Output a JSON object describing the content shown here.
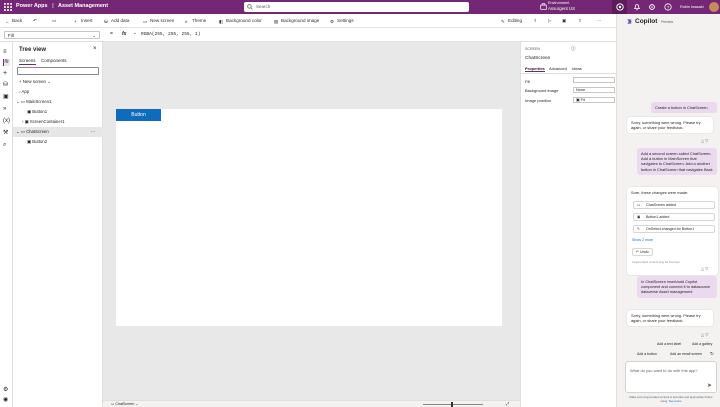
{
  "header": {
    "app_name": "Power Apps",
    "separator": "|",
    "project": "Asset Management",
    "search_placeholder": "Search",
    "environment_label": "Environment",
    "environment_name": "Assurgent US",
    "user_name": "Robin Iwasaki"
  },
  "toolbar": {
    "back": "Back",
    "insert": "Insert",
    "add_data": "Add data",
    "new_screen": "New screen",
    "theme": "Theme",
    "background_color": "Background color",
    "background_image": "Background image",
    "settings": "Settings",
    "editing": "Editing"
  },
  "formula": {
    "property": "Fill",
    "fx": "fx",
    "expression": "RGBA(255, 255, 255, 1)"
  },
  "tree": {
    "title": "Tree view",
    "tabs": [
      "Screens",
      "Components"
    ],
    "new_screen": "New screen",
    "nodes": [
      {
        "label": "App"
      },
      {
        "label": "MainScreen1"
      },
      {
        "label": "Button1"
      },
      {
        "label": "ScreenContainer1"
      },
      {
        "label": "ChatScreen"
      },
      {
        "label": "Button2"
      }
    ]
  },
  "canvas": {
    "button_label": "Button",
    "screen_tab": "ChatScreen"
  },
  "properties": {
    "kind": "SCREEN",
    "name": "ChatScreen",
    "tabs": [
      "Properties",
      "Advanced",
      "Ideas"
    ],
    "rows": [
      {
        "label": "Fill",
        "value": ""
      },
      {
        "label": "Background image",
        "value": "None"
      },
      {
        "label": "Image position",
        "value": "Fit"
      }
    ]
  },
  "copilot": {
    "title": "Copilot",
    "badge": "Preview",
    "messages": [
      {
        "role": "user",
        "text": "Create a button in ChatScreen"
      },
      {
        "role": "bot",
        "text": "Sorry, something went wrong. Please try again, or share your feedback."
      },
      {
        "role": "user",
        "text": "Add a second screen called ChatScreen. Add a button in MainScreen that navigates to ChatScreen. Add a another button in ChatScreen that navigates Back"
      },
      {
        "role": "bot",
        "text": "Sure, these changes were made:"
      },
      {
        "role": "user",
        "text": "In ChatScreen insert/add Copilot component and connect it to datasource dataverse Asset management"
      },
      {
        "role": "bot",
        "text": "Sorry, something went wrong. Please try again, or share your feedback."
      }
    ],
    "changes": [
      "ChatScreen added",
      "Button1 added",
      "OnSelect changed for Button1"
    ],
    "show_more": "Show 2 more",
    "undo": "Undo",
    "ai_note": "AI-generated content may be incorrect",
    "suggestions": [
      "Add a text label",
      "Add a gallery",
      "Add a button",
      "Add an email screen"
    ],
    "input_placeholder": "What do you want to do with this app?",
    "footer": "Make sure AI-generated content is accurate and appropriate before using.",
    "footer_link": "See terms"
  },
  "colors": {
    "header": "#742774",
    "accent": "#0f6cbd",
    "user_bubble": "#ead9ef"
  }
}
